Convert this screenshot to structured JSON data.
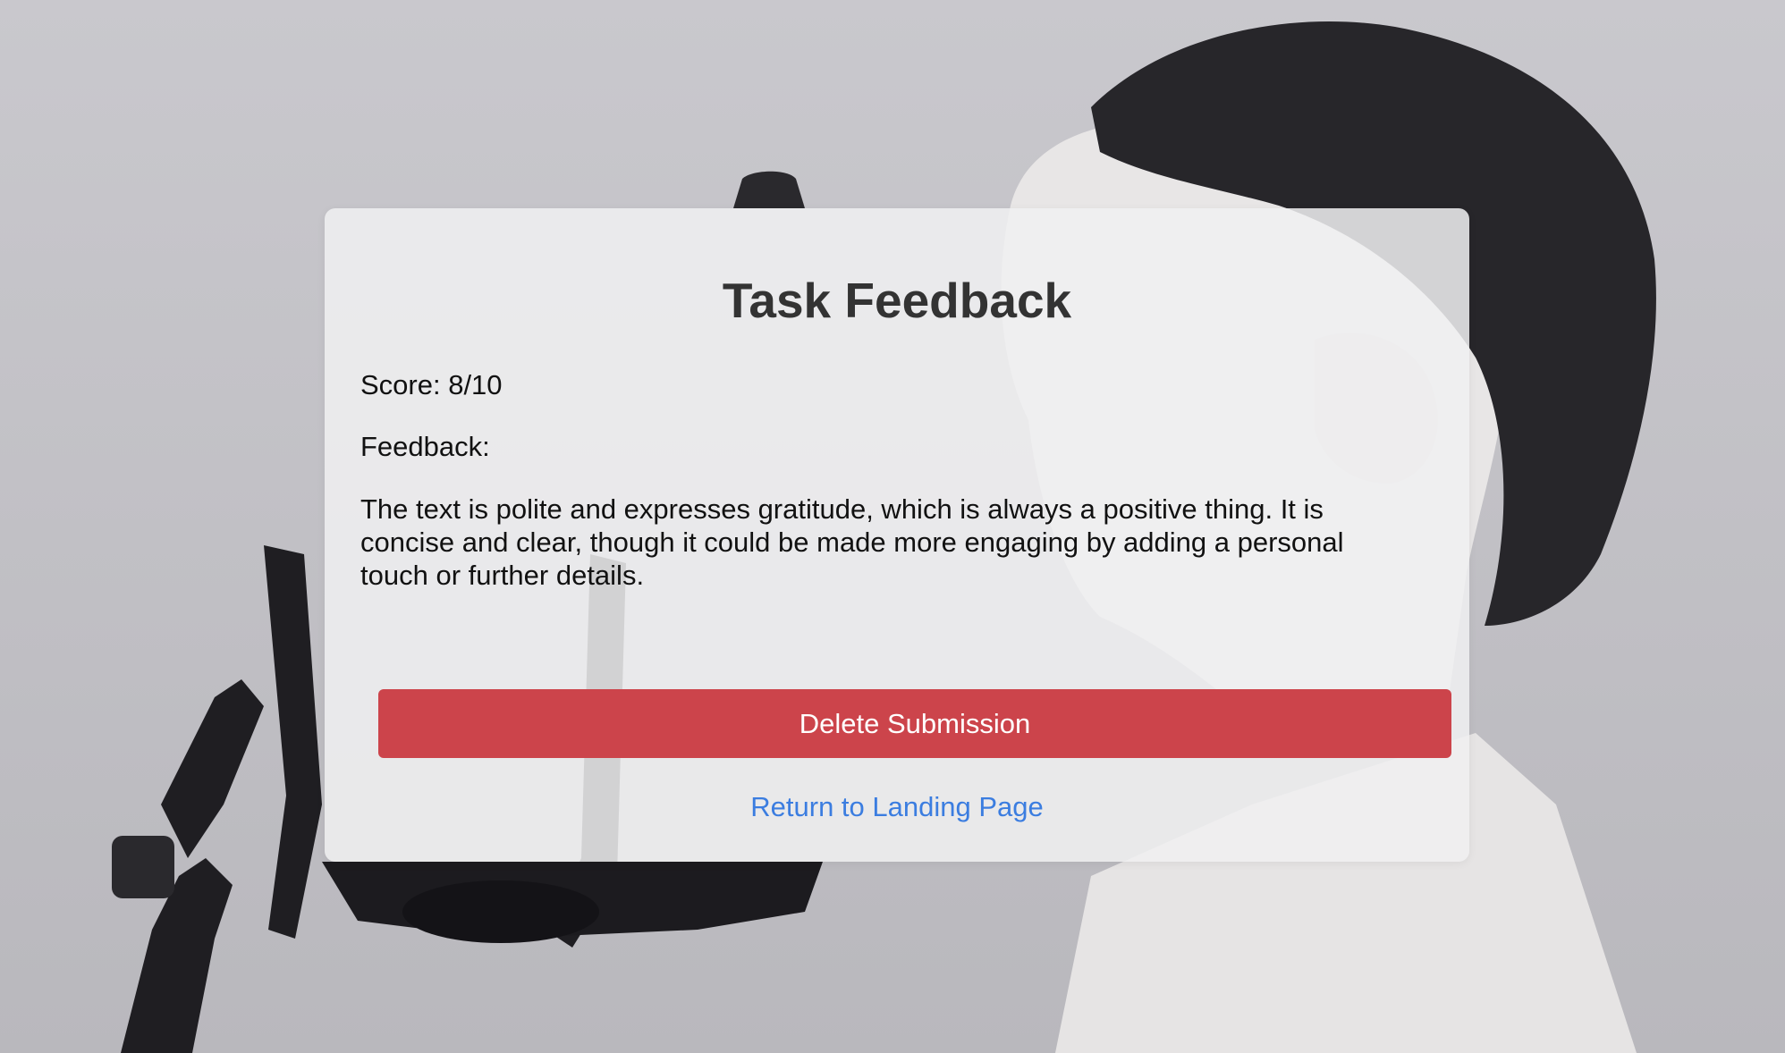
{
  "page": {
    "background_image": "boy-singing-into-studio-microphone-photo"
  },
  "card": {
    "title": "Task Feedback",
    "score_label": "Score: 8/10",
    "feedback_label": "Feedback:",
    "feedback_text": "The text is polite and expresses gratitude, which is always a positive thing. It is concise and clear, though it could be made more engaging by adding a personal touch or further details.",
    "delete_button_label": "Delete Submission",
    "return_link_label": "Return to Landing Page"
  },
  "colors": {
    "delete_button": "#cc444b",
    "link": "#3b7de0",
    "title": "#333333"
  }
}
